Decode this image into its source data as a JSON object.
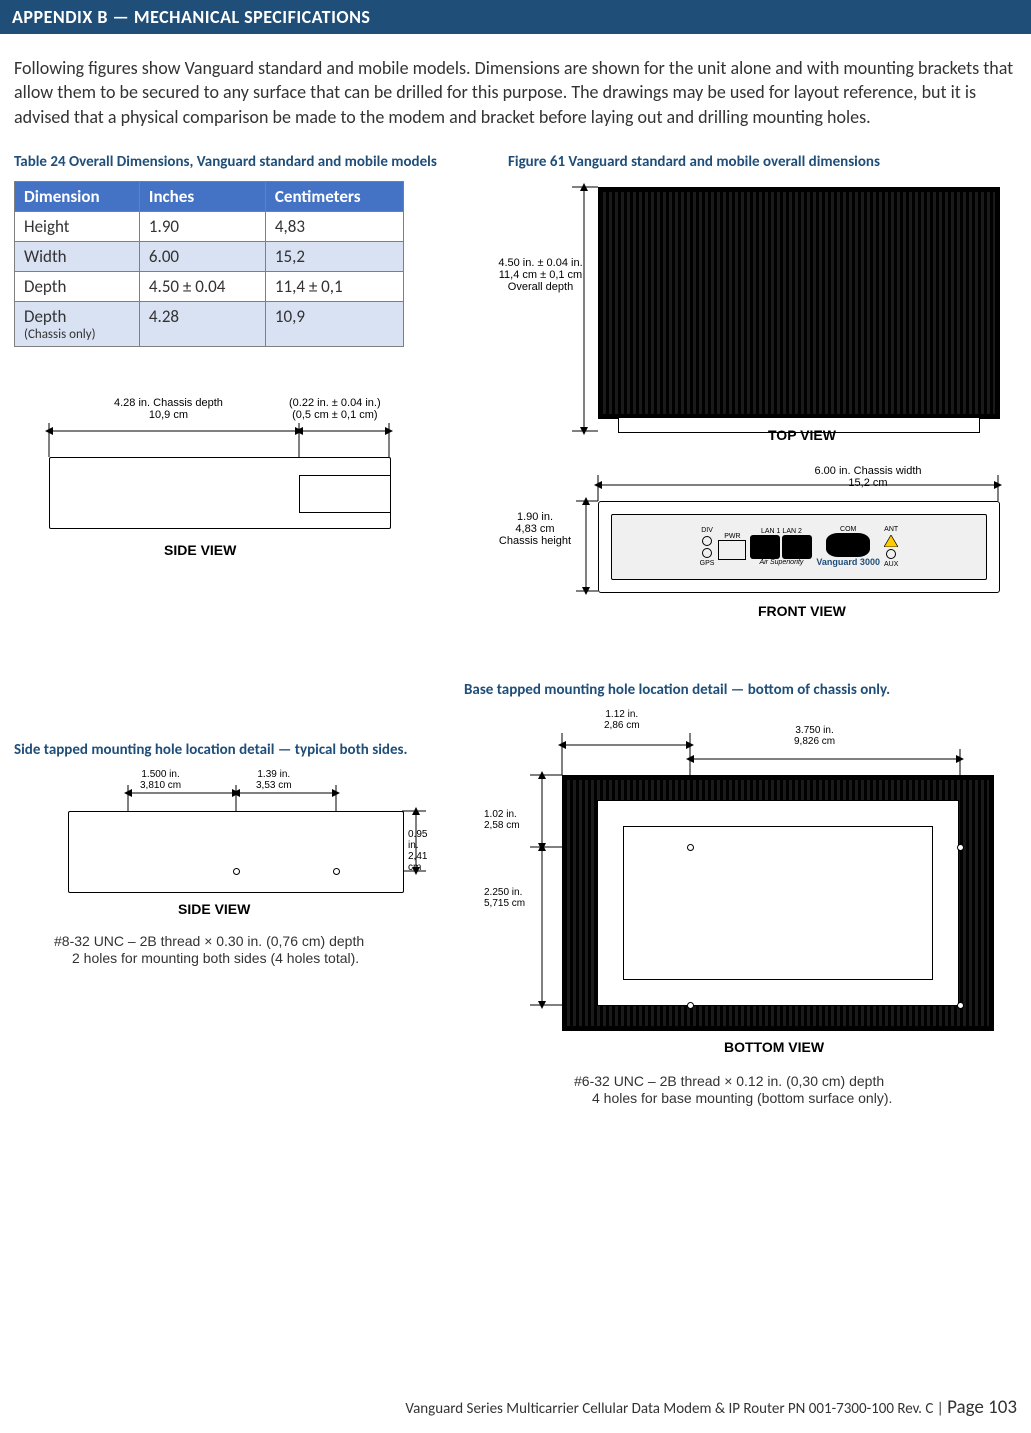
{
  "header": {
    "title": "APPENDIX B — MECHANICAL SPECIFICATIONS"
  },
  "intro": "Following figures show Vanguard  standard and mobile models. Dimensions are shown for the unit alone and with mounting brackets that allow them to be secured to any surface that can be drilled for this purpose. The drawings may be used for layout reference, but it is advised that a physical comparison be made to the modem and bracket before laying out and drilling mounting holes.",
  "table24": {
    "caption": "Table 24 Overall Dimensions, Vanguard  standard and mobile models",
    "headers": {
      "dim": "Dimension",
      "in": "Inches",
      "cm": "Centimeters"
    },
    "rows": [
      {
        "dim": "Height",
        "in": "1.90",
        "cm": "4,83"
      },
      {
        "dim": "Width",
        "in": "6.00",
        "cm": "15,2"
      },
      {
        "dim": "Depth",
        "in": "4.50 ± 0.04",
        "cm": "11,4 ± 0,1"
      },
      {
        "dim": "Depth",
        "sub": "(Chassis only)",
        "in": "4.28",
        "cm": "10,9"
      }
    ]
  },
  "fig61": {
    "caption": "Figure 61 Vanguard  standard and mobile overall dimensions"
  },
  "sideview_small": {
    "chassis_depth_in": "4.28 in.",
    "chassis_depth_lbl": "Chassis depth",
    "chassis_depth_cm": "10,9 cm",
    "connector_in": "(0.22 in. ± 0.04 in.)",
    "connector_cm": "(0,5 cm ± 0,1 cm)",
    "view_label": "SIDE VIEW"
  },
  "topview": {
    "overall_depth_in": "4.50 in. ± 0.04 in.",
    "overall_depth_cm": "11,4 cm ± 0,1 cm",
    "overall_depth_lbl": "Overall depth",
    "view_label": "TOP VIEW"
  },
  "frontview": {
    "width_in": "6.00 in.",
    "width_cm": "15,2 cm",
    "width_lbl": "Chassis width",
    "height_in": "1.90 in.",
    "height_cm": "4,83 cm",
    "height_lbl": "Chassis height",
    "ports": {
      "div": "DIV",
      "gps": "GPS",
      "pwr": "PWR",
      "lan1": "LAN 1",
      "lan2": "LAN 2",
      "com": "COM",
      "ant": "ANT",
      "aux": "AUX"
    },
    "brand_sub": "Air Superiority",
    "product": "Vanguard 3000",
    "view_label": "FRONT VIEW"
  },
  "side_tapped": {
    "caption": "Side tapped mounting hole location detail — typical both sides.",
    "d1_in": "1.500 in.",
    "d1_cm": "3,810 cm",
    "d2_in": "1.39 in.",
    "d2_cm": "3,53 cm",
    "d3_in": "0.95 in.",
    "d3_cm": "2,41 cm",
    "view_label": "SIDE VIEW",
    "note_l1": "#8-32 UNC – 2B thread × 0.30 in. (0,76 cm) depth",
    "note_l2": "2 holes for mounting both sides (4 holes total)."
  },
  "base_tapped": {
    "caption": "Base tapped mounting hole location detail — bottom of chassis only.",
    "dA_in": "1.12 in.",
    "dA_cm": "2,86 cm",
    "dB_in": "3.750 in.",
    "dB_cm": "9,826 cm",
    "dC_in": "1.02 in.",
    "dC_cm": "2,58 cm",
    "dD_in": "2.250 in.",
    "dD_cm": "5,715 cm",
    "view_label": "BOTTOM VIEW",
    "note_l1": "#6-32 UNC – 2B thread × 0.12 in. (0,30 cm) depth",
    "note_l2": "4 holes for base mounting (bottom surface only)."
  },
  "footer": {
    "left": "Vanguard Series Multicarrier Cellular Data Modem & IP Router PN 001-7300-100 Rev. C",
    "sep": " | ",
    "page_label": "Page ",
    "page_num": "103"
  },
  "chart_data": [
    {
      "type": "table",
      "title": "Overall Dimensions, Vanguard standard and mobile models",
      "columns": [
        "Dimension",
        "Inches",
        "Centimeters"
      ],
      "rows": [
        [
          "Height",
          "1.90",
          "4,83"
        ],
        [
          "Width",
          "6.00",
          "15,2"
        ],
        [
          "Depth",
          "4.50 ± 0.04",
          "11,4 ± 0,1"
        ],
        [
          "Depth (Chassis only)",
          "4.28",
          "10,9"
        ]
      ]
    }
  ]
}
